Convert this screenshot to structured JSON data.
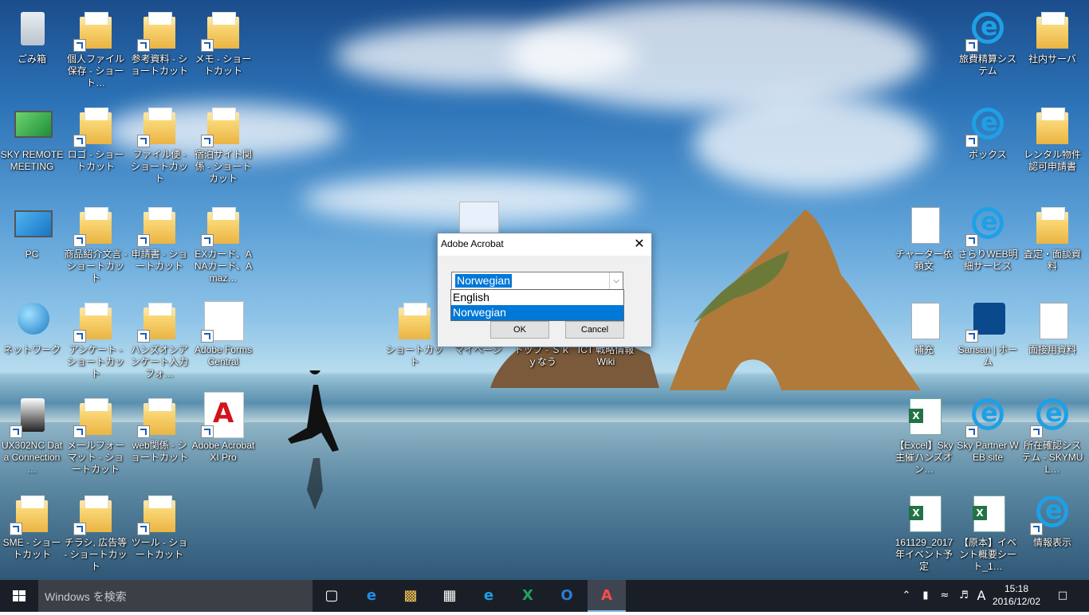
{
  "desktop_icons": [
    {
      "label": "ごみ箱",
      "icon": "recycle-bin-icon"
    },
    {
      "label": "個人ファイル保存 - ショート…",
      "icon": "folder-icon"
    },
    {
      "label": "参考資料 - ショートカット",
      "icon": "folder-icon"
    },
    {
      "label": "メモ - ショートカット",
      "icon": "folder-icon"
    },
    {
      "label": "SKY REMOTE MEETING",
      "icon": "phone-app-icon"
    },
    {
      "label": "ロゴ - ショートカット",
      "icon": "folder-icon"
    },
    {
      "label": "ファイル便 - ショートカット",
      "icon": "folder-icon"
    },
    {
      "label": "宿泊サイト関係 - ショートカット",
      "icon": "folder-icon"
    },
    {
      "label": "PC",
      "icon": "computer-icon"
    },
    {
      "label": "商品紹介文言 - ショートカット",
      "icon": "folder-icon"
    },
    {
      "label": "申請書 - ショートカット",
      "icon": "folder-icon"
    },
    {
      "label": "EXカード、ANAカード、Amaz…",
      "icon": "folder-icon"
    },
    {
      "label": "ネットワーク",
      "icon": "network-icon"
    },
    {
      "label": "アンケート - ショートカット",
      "icon": "folder-icon"
    },
    {
      "label": "ハンズオンアンケート入力フォ…",
      "icon": "folder-icon"
    },
    {
      "label": "Adobe FormsCentral",
      "icon": "forms-app-icon"
    },
    {
      "label": "UX302NC Data Connection …",
      "icon": "usb-device-icon"
    },
    {
      "label": "メールフォーマット - ショートカット",
      "icon": "folder-icon"
    },
    {
      "label": "web関係 - ショートカット",
      "icon": "folder-icon"
    },
    {
      "label": "Adobe Acrobat XI Pro",
      "icon": "acrobat-icon"
    },
    {
      "label": "SME - ショートカット",
      "icon": "folder-icon"
    },
    {
      "label": "チラシ, 広告等 - ショートカット",
      "icon": "folder-icon"
    },
    {
      "label": "ツール - ショートカット",
      "icon": "folder-icon"
    },
    {
      "label": "ショートカット",
      "icon": "excel-folder-icon"
    },
    {
      "label": "マイページ",
      "icon": "ie-icon"
    },
    {
      "label": "トップ - Ｓｋｙなう",
      "icon": "ie-icon"
    },
    {
      "label": "ICT 戦略情報 Wiki",
      "icon": "ie-icon"
    },
    {
      "label": "旅費精算システム",
      "icon": "ie-icon"
    },
    {
      "label": "社内サーバ",
      "icon": "folder-icon"
    },
    {
      "label": "ボックス",
      "icon": "ie-icon"
    },
    {
      "label": "レンタル物件認可申請書",
      "icon": "folder-icon"
    },
    {
      "label": "チャーター依頼文",
      "icon": "document-icon"
    },
    {
      "label": "さらりWEB明細サービス",
      "icon": "ie-icon"
    },
    {
      "label": "査定・面談資料",
      "icon": "folder-icon"
    },
    {
      "label": "補充",
      "icon": "document-icon"
    },
    {
      "label": "Sansan | ホーム",
      "icon": "sansan-icon"
    },
    {
      "label": "面接用資料",
      "icon": "document-icon"
    },
    {
      "label": "【Excel】Sky主催ハンズオン…",
      "icon": "excel-icon"
    },
    {
      "label": "Sky Partner WEB site",
      "icon": "ie-icon"
    },
    {
      "label": "所在確認システム - SKYMUL…",
      "icon": "ie-icon"
    },
    {
      "label": "161129_2017年イベント予定",
      "icon": "excel-icon"
    },
    {
      "label": "【原本】イベント概要シート_1…",
      "icon": "excel-icon"
    },
    {
      "label": "情報表示",
      "icon": "ie-icon"
    }
  ],
  "dialog": {
    "title": "Adobe Acrobat",
    "close_glyph": "✕",
    "selected_value": "Norwegian",
    "options": [
      "English",
      "Norwegian"
    ],
    "selected_option": "Norwegian",
    "ok_label": "OK",
    "cancel_label": "Cancel",
    "accent": "#0078d7"
  },
  "taskbar": {
    "search_placeholder": "Windows を検索",
    "apps": [
      "task-view-icon",
      "edge-icon",
      "file-explorer-icon",
      "store-icon",
      "ie-icon",
      "excel-icon",
      "outlook-icon",
      "acrobat-icon"
    ],
    "active_app": "acrobat-icon",
    "ime": "A",
    "time": "15:18",
    "date": "2016/12/02",
    "color": "#1a1f27"
  }
}
